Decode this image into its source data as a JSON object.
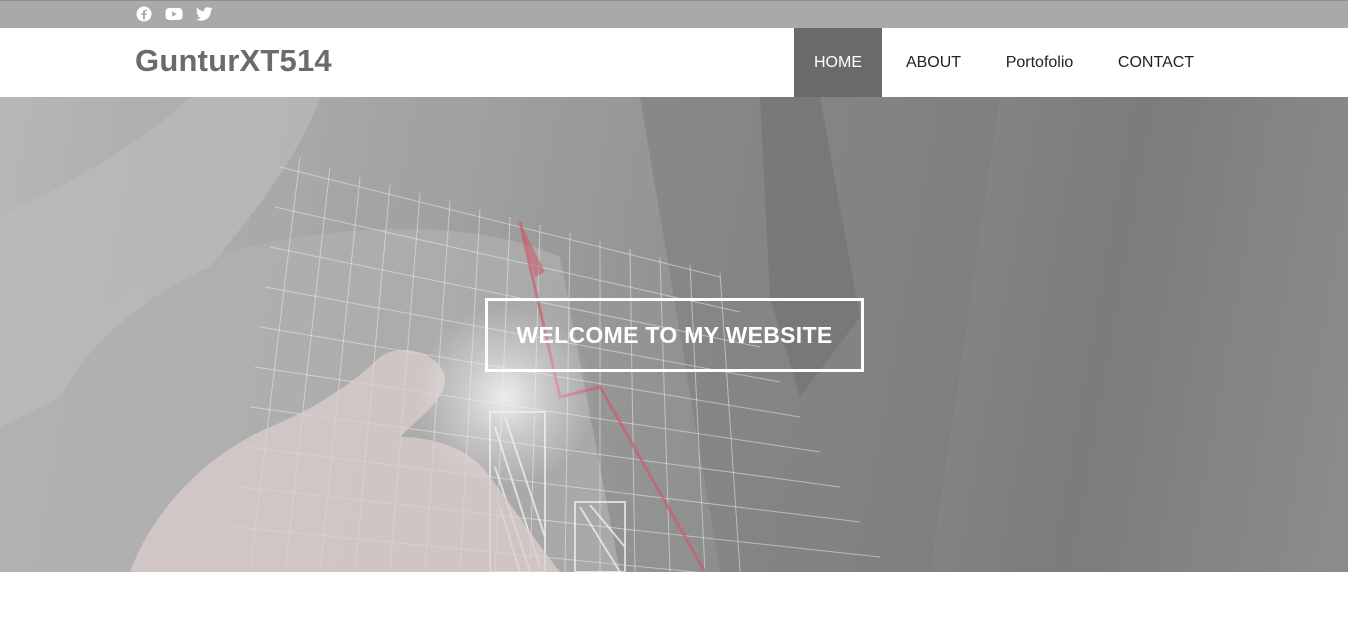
{
  "topbar": {
    "social": [
      {
        "name": "facebook-icon"
      },
      {
        "name": "youtube-icon"
      },
      {
        "name": "twitter-icon"
      }
    ]
  },
  "header": {
    "brand": "GunturXT514",
    "nav": [
      {
        "label": "HOME",
        "active": true
      },
      {
        "label": "ABOUT",
        "active": false
      },
      {
        "label": "Portofolio",
        "active": false
      },
      {
        "label": "CONTACT",
        "active": false
      }
    ]
  },
  "hero": {
    "welcome": "WELCOME TO MY WEBSITE"
  },
  "colors": {
    "topbar": "#a9a9a9",
    "brand": "#6b6b6b",
    "nav_active": "#6a6a6a",
    "accent_line": "#d9566b"
  }
}
